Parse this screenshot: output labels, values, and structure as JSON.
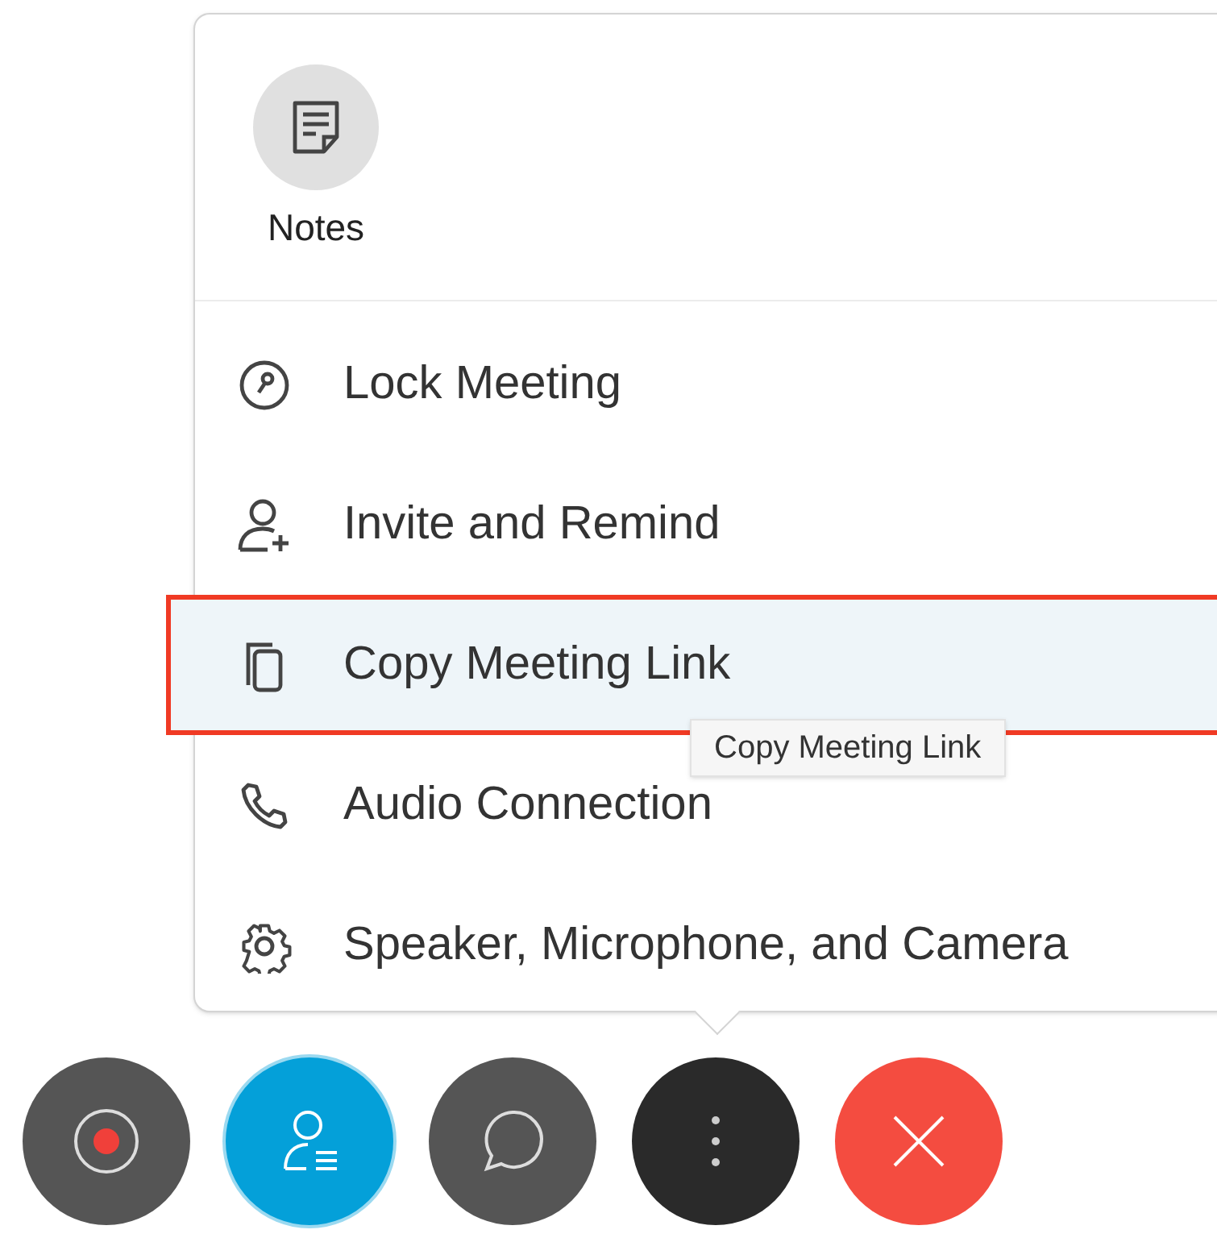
{
  "notes": {
    "label": "Notes"
  },
  "menu_items": [
    {
      "label": "Lock Meeting",
      "kind": "lock",
      "selected": false
    },
    {
      "label": "Invite and Remind",
      "kind": "invite",
      "selected": false
    },
    {
      "label": "Copy Meeting Link",
      "kind": "copy",
      "selected": true
    },
    {
      "label": "Audio Connection",
      "kind": "audio",
      "selected": false
    },
    {
      "label": "Speaker, Microphone, and Camera",
      "kind": "settings",
      "selected": false
    }
  ],
  "tooltip": "Copy Meeting Link",
  "toolbar": [
    {
      "kind": "record",
      "selected": false
    },
    {
      "kind": "participants",
      "selected": true
    },
    {
      "kind": "chat",
      "selected": false
    },
    {
      "kind": "more",
      "selected": false
    },
    {
      "kind": "leave",
      "selected": false
    }
  ]
}
